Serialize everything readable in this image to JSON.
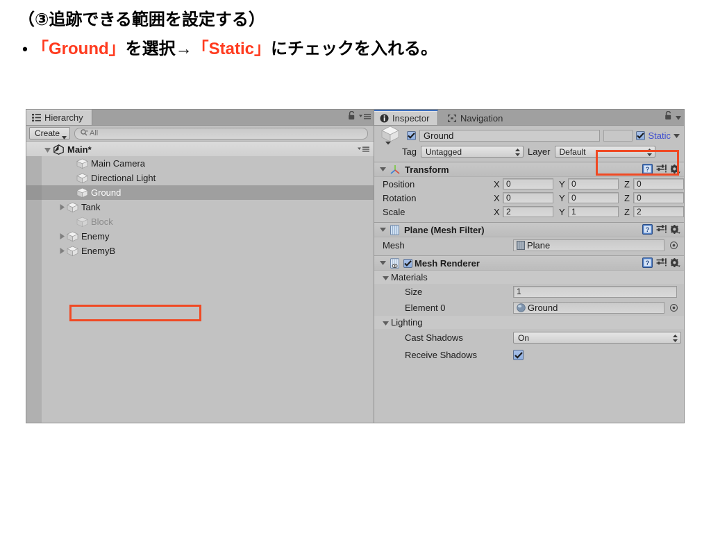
{
  "slide": {
    "heading": "（③追跡できる範囲を設定する）",
    "bullet_mark": "•",
    "bullet_parts": {
      "p1": "「Ground」",
      "p2": "を選択→",
      "p3": "「Static」",
      "p4": "にチェックを入れる。"
    },
    "highlight_color": "#ff3b1f"
  },
  "hierarchy": {
    "tab_label": "Hierarchy",
    "tab_icon": "hierarchy-icon",
    "lock_icon": "lock-icon",
    "menu_icon": "menu-icon",
    "create_label": "Create",
    "search_placeholder": "All",
    "search_value": "",
    "search_icon": "search-icon",
    "scene_row": {
      "label": "Main*",
      "icon": "unity-logo-icon",
      "expanded": true
    },
    "items": [
      {
        "label": "Main Camera",
        "icon": "gameobject-cube-icon",
        "arrow": false,
        "selected": false,
        "dim": false
      },
      {
        "label": "Directional Light",
        "icon": "gameobject-cube-icon",
        "arrow": false,
        "selected": false,
        "dim": false
      },
      {
        "label": "Ground",
        "icon": "gameobject-cube-icon",
        "arrow": false,
        "selected": true,
        "dim": false
      },
      {
        "label": "Tank",
        "icon": "gameobject-cube-icon",
        "arrow": true,
        "selected": false,
        "dim": false
      },
      {
        "label": "Block",
        "icon": "gameobject-cube-icon",
        "arrow": false,
        "selected": false,
        "dim": true
      },
      {
        "label": "Enemy",
        "icon": "gameobject-cube-icon",
        "arrow": true,
        "selected": false,
        "dim": false
      },
      {
        "label": "EnemyB",
        "icon": "gameobject-cube-icon",
        "arrow": true,
        "selected": false,
        "dim": false
      }
    ]
  },
  "inspector": {
    "tabs": [
      {
        "label": "Inspector",
        "icon": "info-icon",
        "active": true
      },
      {
        "label": "Navigation",
        "icon": "navigation-icon",
        "active": false
      }
    ],
    "lock_icon": "lock-icon",
    "menu_icon": "menu-icon",
    "object": {
      "icon": "gameobject-cube-icon",
      "enabled_checkbox": true,
      "name": "Ground",
      "static_checkbox": true,
      "static_label": "Static",
      "static_dropdown_icon": "chevron-down-icon",
      "tag_label": "Tag",
      "tag_value": "Untagged",
      "layer_label": "Layer",
      "layer_value": "Default"
    },
    "components": [
      {
        "title": "Transform",
        "icon": "transform-axis-icon",
        "help_icon": "help-book-icon",
        "preset_icon": "preset-sliders-icon",
        "gear_icon": "gear-icon",
        "rows": [
          {
            "name": "Position",
            "x": "0",
            "y": "0",
            "z": "0"
          },
          {
            "name": "Rotation",
            "x": "0",
            "y": "0",
            "z": "0"
          },
          {
            "name": "Scale",
            "x": "2",
            "y": "1",
            "z": "2"
          }
        ]
      },
      {
        "title": "Plane (Mesh Filter)",
        "icon": "mesh-filter-icon",
        "help_icon": "help-book-icon",
        "preset_icon": "preset-sliders-icon",
        "gear_icon": "gear-icon",
        "mesh_label": "Mesh",
        "mesh_value": "Plane",
        "mesh_value_icon": "mesh-asset-icon",
        "picker_icon": "object-picker-icon"
      },
      {
        "title": "Mesh Renderer",
        "icon": "mesh-renderer-icon",
        "enabled_checkbox": true,
        "help_icon": "help-book-icon",
        "preset_icon": "preset-sliders-icon",
        "gear_icon": "gear-icon",
        "materials_label": "Materials",
        "size_label": "Size",
        "size_value": "1",
        "element0_label": "Element 0",
        "element0_value": "Ground",
        "element0_icon": "material-sphere-icon",
        "picker_icon": "object-picker-icon",
        "lighting_label": "Lighting",
        "cast_shadows_label": "Cast Shadows",
        "cast_shadows_value": "On",
        "receive_shadows_label": "Receive Shadows",
        "receive_shadows_checked": true
      }
    ]
  },
  "annotations": {
    "ground_box_color": "#f04923",
    "static_box_color": "#f04923"
  }
}
